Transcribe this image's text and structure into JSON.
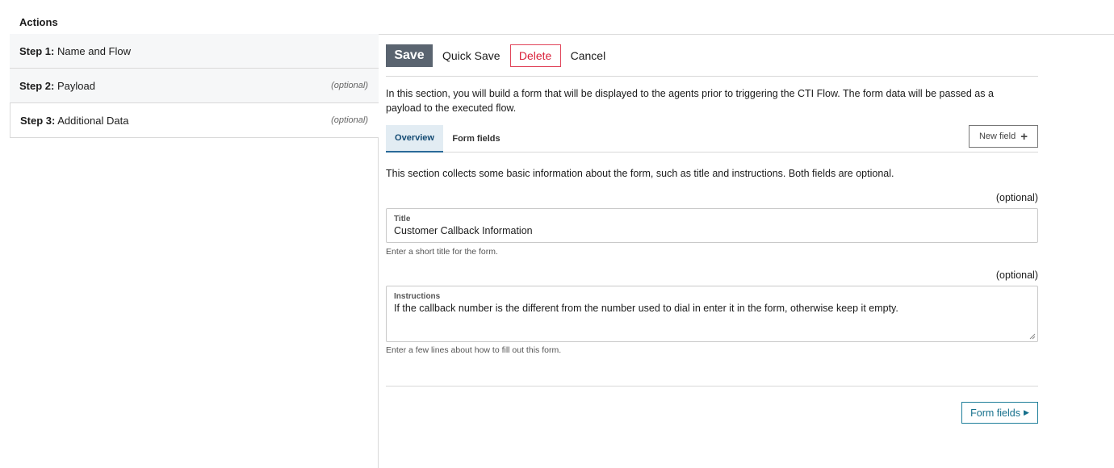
{
  "page": {
    "actions_title": "Actions"
  },
  "steps": [
    {
      "prefix": "Step 1:",
      "label": "Name and Flow",
      "optional": ""
    },
    {
      "prefix": "Step 2:",
      "label": "Payload",
      "optional": "(optional)"
    },
    {
      "prefix": "Step 3:",
      "label": "Additional Data",
      "optional": "(optional)"
    }
  ],
  "toolbar": {
    "save": "Save",
    "quick_save": "Quick Save",
    "delete": "Delete",
    "cancel": "Cancel"
  },
  "intro": "In this section, you will build a form that will be displayed to the agents prior to triggering the CTI Flow. The form data will be passed as a payload to the executed flow.",
  "tabs": [
    {
      "label": "Overview"
    },
    {
      "label": "Form fields"
    }
  ],
  "new_field": {
    "label": "New field",
    "icon": "plus-icon"
  },
  "overview": {
    "description": "This section collects some basic information about the form, such as title and instructions. Both fields are optional.",
    "title_field": {
      "optional": "(optional)",
      "label": "Title",
      "value": "Customer Callback Information",
      "help": "Enter a short title for the form."
    },
    "instructions_field": {
      "optional": "(optional)",
      "label": "Instructions",
      "value": "If the callback number is the different from the number used to dial in enter it in the form, otherwise keep it empty.",
      "help": "Enter a few lines about how to fill out this form."
    }
  },
  "next_button": {
    "label": "Form fields",
    "icon": "caret-right-icon"
  },
  "colors": {
    "save_bg": "#5a6470",
    "delete": "#d9213a",
    "tab_active_bg": "#e2ecf3",
    "accent": "#16708c"
  }
}
